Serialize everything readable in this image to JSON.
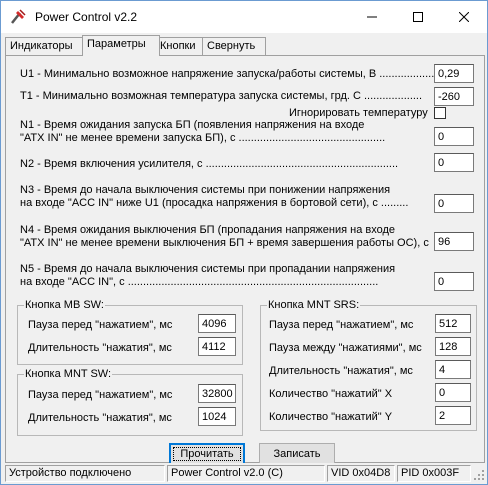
{
  "window": {
    "title": "Power Control v2.2"
  },
  "tabs": [
    "Индикаторы",
    "Параметры",
    "Кнопки",
    "Свернуть"
  ],
  "params": {
    "u1_label": "U1 - Минимально возможное напряжение запуска/работы системы, В ...................",
    "u1_value": "0,29",
    "t1_label": "T1 - Минимально возможная температура запуска системы, грд. С ...................",
    "t1_value": "-260",
    "ignore_temp_label": "Игнорировать температуру",
    "n1_line1": "N1 - Время ожидания запуска БП (появления напряжения на входе",
    "n1_line2": "\"ATX IN\" не менее времени запуска БП), с ................................................",
    "n1_value": "0",
    "n2_label": "N2 - Время включения усилителя, с ...............................................................",
    "n2_value": "0",
    "n3_line1": "N3 - Время до начала выключения системы при понижении напряжения",
    "n3_line2": "на входе \"ACC IN\" ниже U1 (просадка напряжения в бортовой сети), с .........",
    "n3_value": "0",
    "n4_line1": "N4 - Время ожидания выключения БП (пропадания напряжения на входе",
    "n4_line2": "\"ATX IN\" не менее времени выключения БП + время завершения работы ОС), с",
    "n4_value": "96",
    "n5_line1": "N5 - Время до начала выключения системы при пропадании напряжения",
    "n5_line2": "на входе \"ACC IN\", с ..................................................................................",
    "n5_value": "0"
  },
  "mb_sw": {
    "title": "Кнопка MB SW:",
    "pause_label": "Пауза перед \"нажатием\", мс",
    "pause_value": "4096",
    "duration_label": "Длительность \"нажатия\", мс",
    "duration_value": "4112"
  },
  "mnt_sw": {
    "title": "Кнопка MNT SW:",
    "pause_label": "Пауза перед \"нажатием\", мс",
    "pause_value": "32800",
    "duration_label": "Длительность \"нажатия\", мс",
    "duration_value": "1024"
  },
  "mnt_srs": {
    "title": "Кнопка MNT SRS:",
    "pause_label": "Пауза перед \"нажатием\", мс",
    "pause_value": "512",
    "between_label": "Пауза между \"нажатиями\", мс",
    "between_value": "128",
    "duration_label": "Длительность \"нажатия\", мс",
    "duration_value": "4",
    "count_x_label": "Количество \"нажатий\" X",
    "count_x_value": "0",
    "count_y_label": "Количество \"нажатий\" Y",
    "count_y_value": "2"
  },
  "buttons": {
    "read": "Прочитать",
    "write": "Записать"
  },
  "status": {
    "device": "Устройство подключено",
    "version": "Power Control v2.0 (C)",
    "vid": "VID 0x04D8",
    "pid": "PID 0x003F"
  },
  "colors": {
    "icon_red": "#d42a2a",
    "focus_blue": "#0078d7"
  }
}
